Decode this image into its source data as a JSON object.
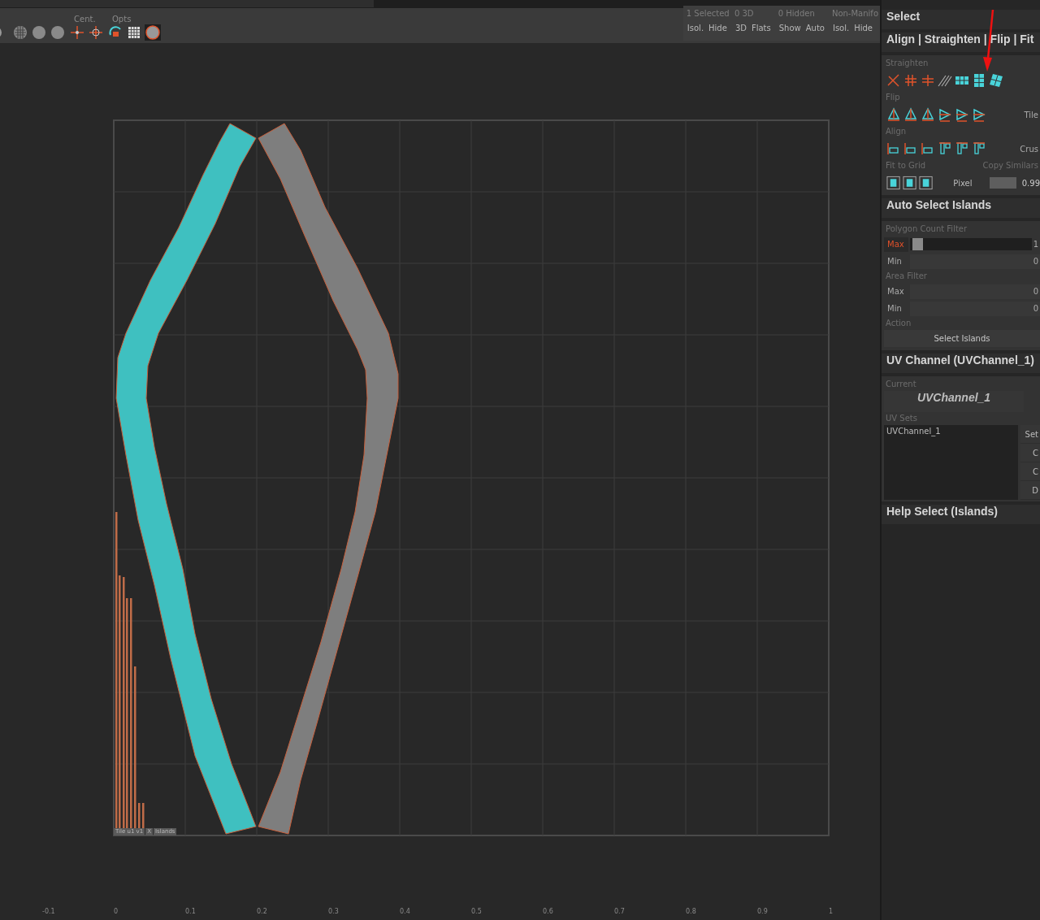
{
  "toolbar": {
    "groups": [
      {
        "kind": "display"
      },
      {
        "kind": "center",
        "label": "Cent."
      },
      {
        "kind": "options",
        "label": "Opts"
      }
    ],
    "stats": [
      {
        "label": "1 Selected",
        "buttons": [
          "Isol.",
          "Hide"
        ]
      },
      {
        "label": "0 3D",
        "buttons": [
          "3D",
          "Flats"
        ]
      },
      {
        "label": "0 Hidden",
        "buttons": [
          "Show",
          "Auto"
        ]
      },
      {
        "label": "Non-Manifo",
        "buttons": [
          "Isol.",
          "Hide"
        ]
      }
    ]
  },
  "viewport": {
    "tile_label": [
      "Tile u1 v1",
      "X",
      "Islands"
    ],
    "ruler": [
      "-0.1",
      "0",
      "0.1",
      "0.2",
      "0.3",
      "0.4",
      "0.5",
      "0.6",
      "0.7",
      "0.8",
      "0.9",
      "1"
    ]
  },
  "panel": {
    "title": "Select",
    "header": "Align | Straighten | Flip | Fit",
    "straighten": {
      "label": "Straighten"
    },
    "flip": {
      "label": "Flip",
      "side": "Tile"
    },
    "align": {
      "label": "Align",
      "side": "Crus"
    },
    "fit": {
      "label": "Fit to Grid",
      "copy_label": "Copy Similars",
      "mode": "Pixel",
      "value": "0.99"
    }
  },
  "auto_select": {
    "title": "Auto Select Islands",
    "filters": [
      {
        "label": "Polygon Count Filter",
        "rows": [
          {
            "kind": "slider",
            "label": "Max",
            "selected": true,
            "level": 0.02,
            "value": "1"
          },
          {
            "kind": "field",
            "label": "Min",
            "selected": false,
            "value": "0"
          }
        ]
      },
      {
        "label": "Area Filter",
        "rows": [
          {
            "kind": "field",
            "label": "Max",
            "selected": false,
            "value": "0"
          },
          {
            "kind": "field",
            "label": "Min",
            "selected": false,
            "value": "0"
          }
        ]
      }
    ],
    "action_label": "Action",
    "action_button": "Select Islands"
  },
  "uv_channel": {
    "title": "UV Channel (UVChannel_1)",
    "current_label": "Current",
    "current": "UVChannel_1",
    "sets_label": "UV Sets",
    "sets": [
      "UVChannel_1"
    ],
    "side_buttons": [
      "Set",
      "C",
      "C",
      "D"
    ]
  },
  "help": {
    "title": "Help Select (Islands)"
  }
}
